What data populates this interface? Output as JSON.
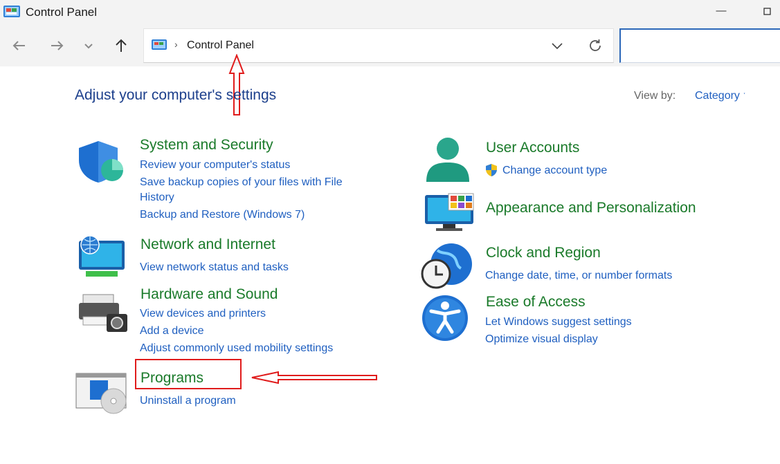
{
  "window": {
    "title": "Control Panel"
  },
  "address": {
    "breadcrumb": "Control Panel",
    "separator": "›"
  },
  "main": {
    "heading": "Adjust your computer's settings",
    "view_by_label": "View by:",
    "view_by_value": "Category ˑ"
  },
  "categories": {
    "system_security": {
      "title": "System and Security",
      "links": [
        "Review your computer's status",
        "Save backup copies of your files with File",
        "History",
        "Backup and Restore (Windows 7)"
      ]
    },
    "network": {
      "title": "Network and Internet",
      "links": [
        "View network status and tasks"
      ]
    },
    "hardware": {
      "title": "Hardware and Sound",
      "links": [
        "View devices and printers",
        "Add a device",
        "Adjust commonly used mobility settings"
      ]
    },
    "programs": {
      "title": "Programs",
      "links": [
        "Uninstall a program"
      ]
    },
    "user_accounts": {
      "title": "User Accounts",
      "links": [
        "Change account type"
      ]
    },
    "appearance": {
      "title": "Appearance and Personalization"
    },
    "clock": {
      "title": "Clock and Region",
      "links": [
        "Change date, time, or number formats"
      ]
    },
    "ease": {
      "title": "Ease of Access",
      "links": [
        "Let Windows suggest settings",
        "Optimize visual display"
      ]
    }
  },
  "colors": {
    "heading": "#1c3f8c",
    "category": "#1a7a2a",
    "link": "#1f5fc0",
    "annotation": "#e01b1b"
  },
  "icons": [
    "back-arrow-icon",
    "forward-arrow-icon",
    "recent-dropdown-icon",
    "up-arrow-icon",
    "control-panel-icon",
    "refresh-icon",
    "shield-icon",
    "globe-monitor-icon",
    "printer-camera-icon",
    "programs-disc-icon",
    "user-icon",
    "uac-shield-icon",
    "monitor-palette-icon",
    "clock-globe-icon",
    "accessibility-icon"
  ]
}
